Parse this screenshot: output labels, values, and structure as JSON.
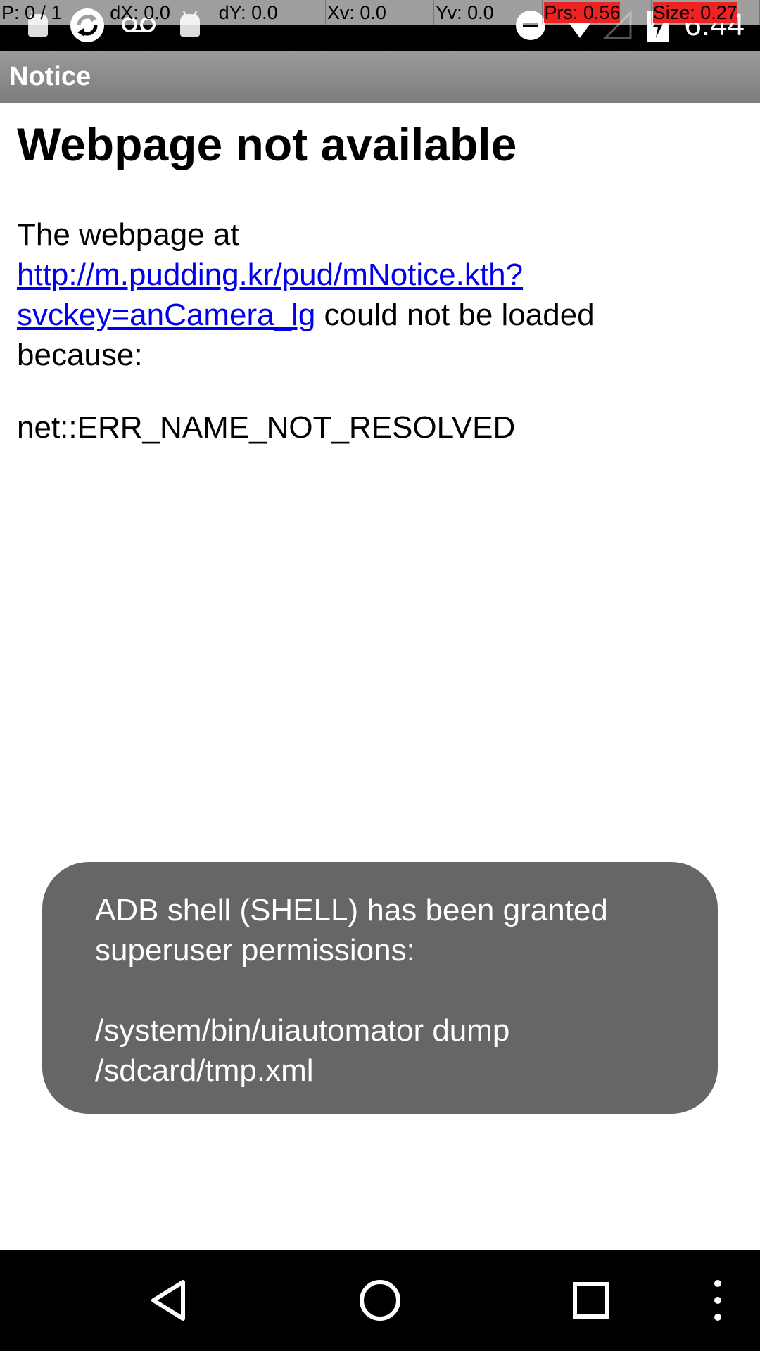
{
  "status_bar": {
    "time": "6:44",
    "icons": [
      "android-icon",
      "sync-icon",
      "voicemail-icon",
      "android-icon",
      "do-not-disturb-icon",
      "wifi-icon",
      "signal-icon",
      "battery-charging-icon"
    ]
  },
  "pointer_overlay": {
    "p": "P: 0 / 1",
    "dx": "dX: 0.0",
    "dy": "dY: 0.0",
    "xv": "Xv: 0.0",
    "yv": "Yv: 0.0",
    "prs": "Prs: 0.56",
    "size": "Size: 0.27"
  },
  "app_bar": {
    "title": "Notice"
  },
  "page": {
    "heading": "Webpage not available",
    "body_prefix": "The webpage at ",
    "url": "http://m.pudding.kr/pud/mNotice.kth?svckey=anCamera_lg",
    "body_suffix": " could not be loaded because:",
    "error_code": "net::ERR_NAME_NOT_RESOLVED"
  },
  "toast": {
    "message": "ADB shell (SHELL) has been granted superuser permissions:\n\n/system/bin/uiautomator dump /sdcard/tmp.xml"
  },
  "nav_bar": {
    "buttons": [
      "back-icon",
      "home-icon",
      "recents-icon",
      "overflow-menu-icon"
    ]
  },
  "colors": {
    "status_bar": "#000000",
    "app_bar": "#8a8a8a",
    "link": "#0000ee",
    "toast_background": "#666666",
    "highlight": "#ee2222"
  }
}
